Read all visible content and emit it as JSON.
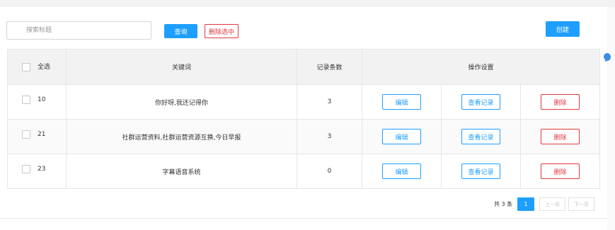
{
  "toolbar": {
    "search_placeholder": "搜索标题",
    "search_label": "查询",
    "delete_selected_label": "删除选中",
    "create_label": "创建"
  },
  "table": {
    "headers": {
      "select_all": "全选",
      "keyword": "关键词",
      "record_count": "记录条数",
      "actions": "操作设置"
    },
    "rows": [
      {
        "id": "10",
        "keyword": "你好呀,我还记得你",
        "count": "3",
        "edit": "编辑",
        "view": "查看记录",
        "delete": "删除"
      },
      {
        "id": "21",
        "keyword": "社群运营资料,社群运营资源互换,今日早报",
        "count": "3",
        "edit": "编辑",
        "view": "查看记录",
        "delete": "删除"
      },
      {
        "id": "23",
        "keyword": "字幕语音系统",
        "count": "0",
        "edit": "编辑",
        "view": "查看记录",
        "delete": "删除"
      }
    ]
  },
  "pagination": {
    "total": "共 3 条",
    "current_page": "1",
    "prev_label": "上一页",
    "next_label": "下一页"
  },
  "colors": {
    "primary": "#1e9fff",
    "danger": "#e0393e",
    "header_bg": "#f2f2f2"
  },
  "icons": {
    "side": "chat-bubble-icon"
  }
}
